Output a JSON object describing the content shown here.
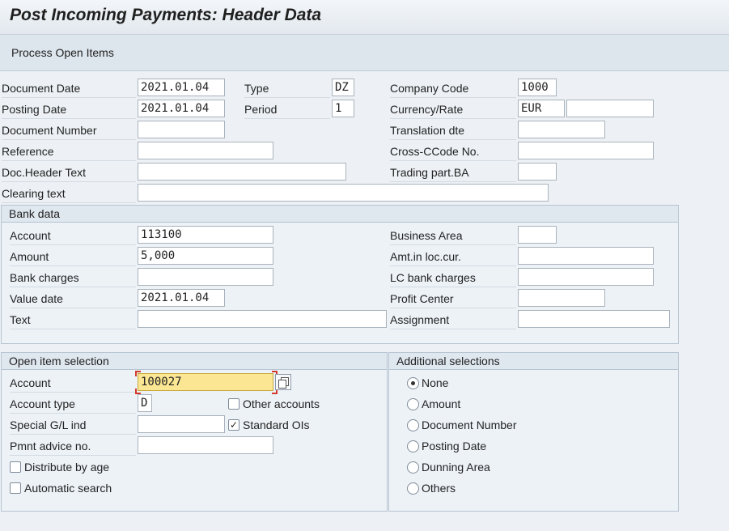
{
  "title": "Post Incoming Payments: Header Data",
  "toolbar": {
    "process_open_items": "Process Open Items"
  },
  "header": {
    "document_date": {
      "label": "Document Date",
      "value": "2021.01.04"
    },
    "posting_date": {
      "label": "Posting Date",
      "value": "2021.01.04"
    },
    "document_number": {
      "label": "Document Number",
      "value": ""
    },
    "reference": {
      "label": "Reference",
      "value": ""
    },
    "doc_header_text": {
      "label": "Doc.Header Text",
      "value": ""
    },
    "clearing_text": {
      "label": "Clearing text",
      "value": ""
    },
    "type": {
      "label": "Type",
      "value": "DZ"
    },
    "period": {
      "label": "Period",
      "value": "1"
    },
    "company_code": {
      "label": "Company Code",
      "value": "1000"
    },
    "currency_rate": {
      "label": "Currency/Rate",
      "currency": "EUR",
      "rate": ""
    },
    "translation_date": {
      "label": "Translation dte",
      "value": ""
    },
    "cross_ccode_no": {
      "label": "Cross-CCode No.",
      "value": ""
    },
    "trading_part_ba": {
      "label": "Trading part.BA",
      "value": ""
    }
  },
  "bank_data": {
    "heading": "Bank data",
    "account": {
      "label": "Account",
      "value": "113100"
    },
    "amount": {
      "label": "Amount",
      "value": "5,000"
    },
    "bank_charges": {
      "label": "Bank charges",
      "value": ""
    },
    "value_date": {
      "label": "Value date",
      "value": "2021.01.04"
    },
    "text": {
      "label": "Text",
      "value": ""
    },
    "business_area": {
      "label": "Business Area",
      "value": ""
    },
    "amt_loc_cur": {
      "label": "Amt.in loc.cur.",
      "value": ""
    },
    "lc_bank_charges": {
      "label": "LC bank charges",
      "value": ""
    },
    "profit_center": {
      "label": "Profit Center",
      "value": ""
    },
    "assignment": {
      "label": "Assignment",
      "value": ""
    }
  },
  "open_item_selection": {
    "heading": "Open item selection",
    "account": {
      "label": "Account",
      "value": "100027"
    },
    "account_type": {
      "label": "Account type",
      "value": "D"
    },
    "special_gl_ind": {
      "label": "Special G/L ind",
      "value": ""
    },
    "pmnt_advice_no": {
      "label": "Pmnt advice no.",
      "value": ""
    },
    "other_accounts": {
      "label": "Other accounts",
      "checked": false
    },
    "standard_ois": {
      "label": "Standard OIs",
      "checked": true
    },
    "distribute_by_age": {
      "label": "Distribute by age",
      "checked": false
    },
    "automatic_search": {
      "label": "Automatic search",
      "checked": false
    }
  },
  "additional_selections": {
    "heading": "Additional selections",
    "selected": "None",
    "options": [
      "None",
      "Amount",
      "Document Number",
      "Posting Date",
      "Dunning Area",
      "Others"
    ]
  },
  "icons": {
    "multiple_selection": "multiple-selection-icon",
    "check": "checkmark-icon"
  }
}
